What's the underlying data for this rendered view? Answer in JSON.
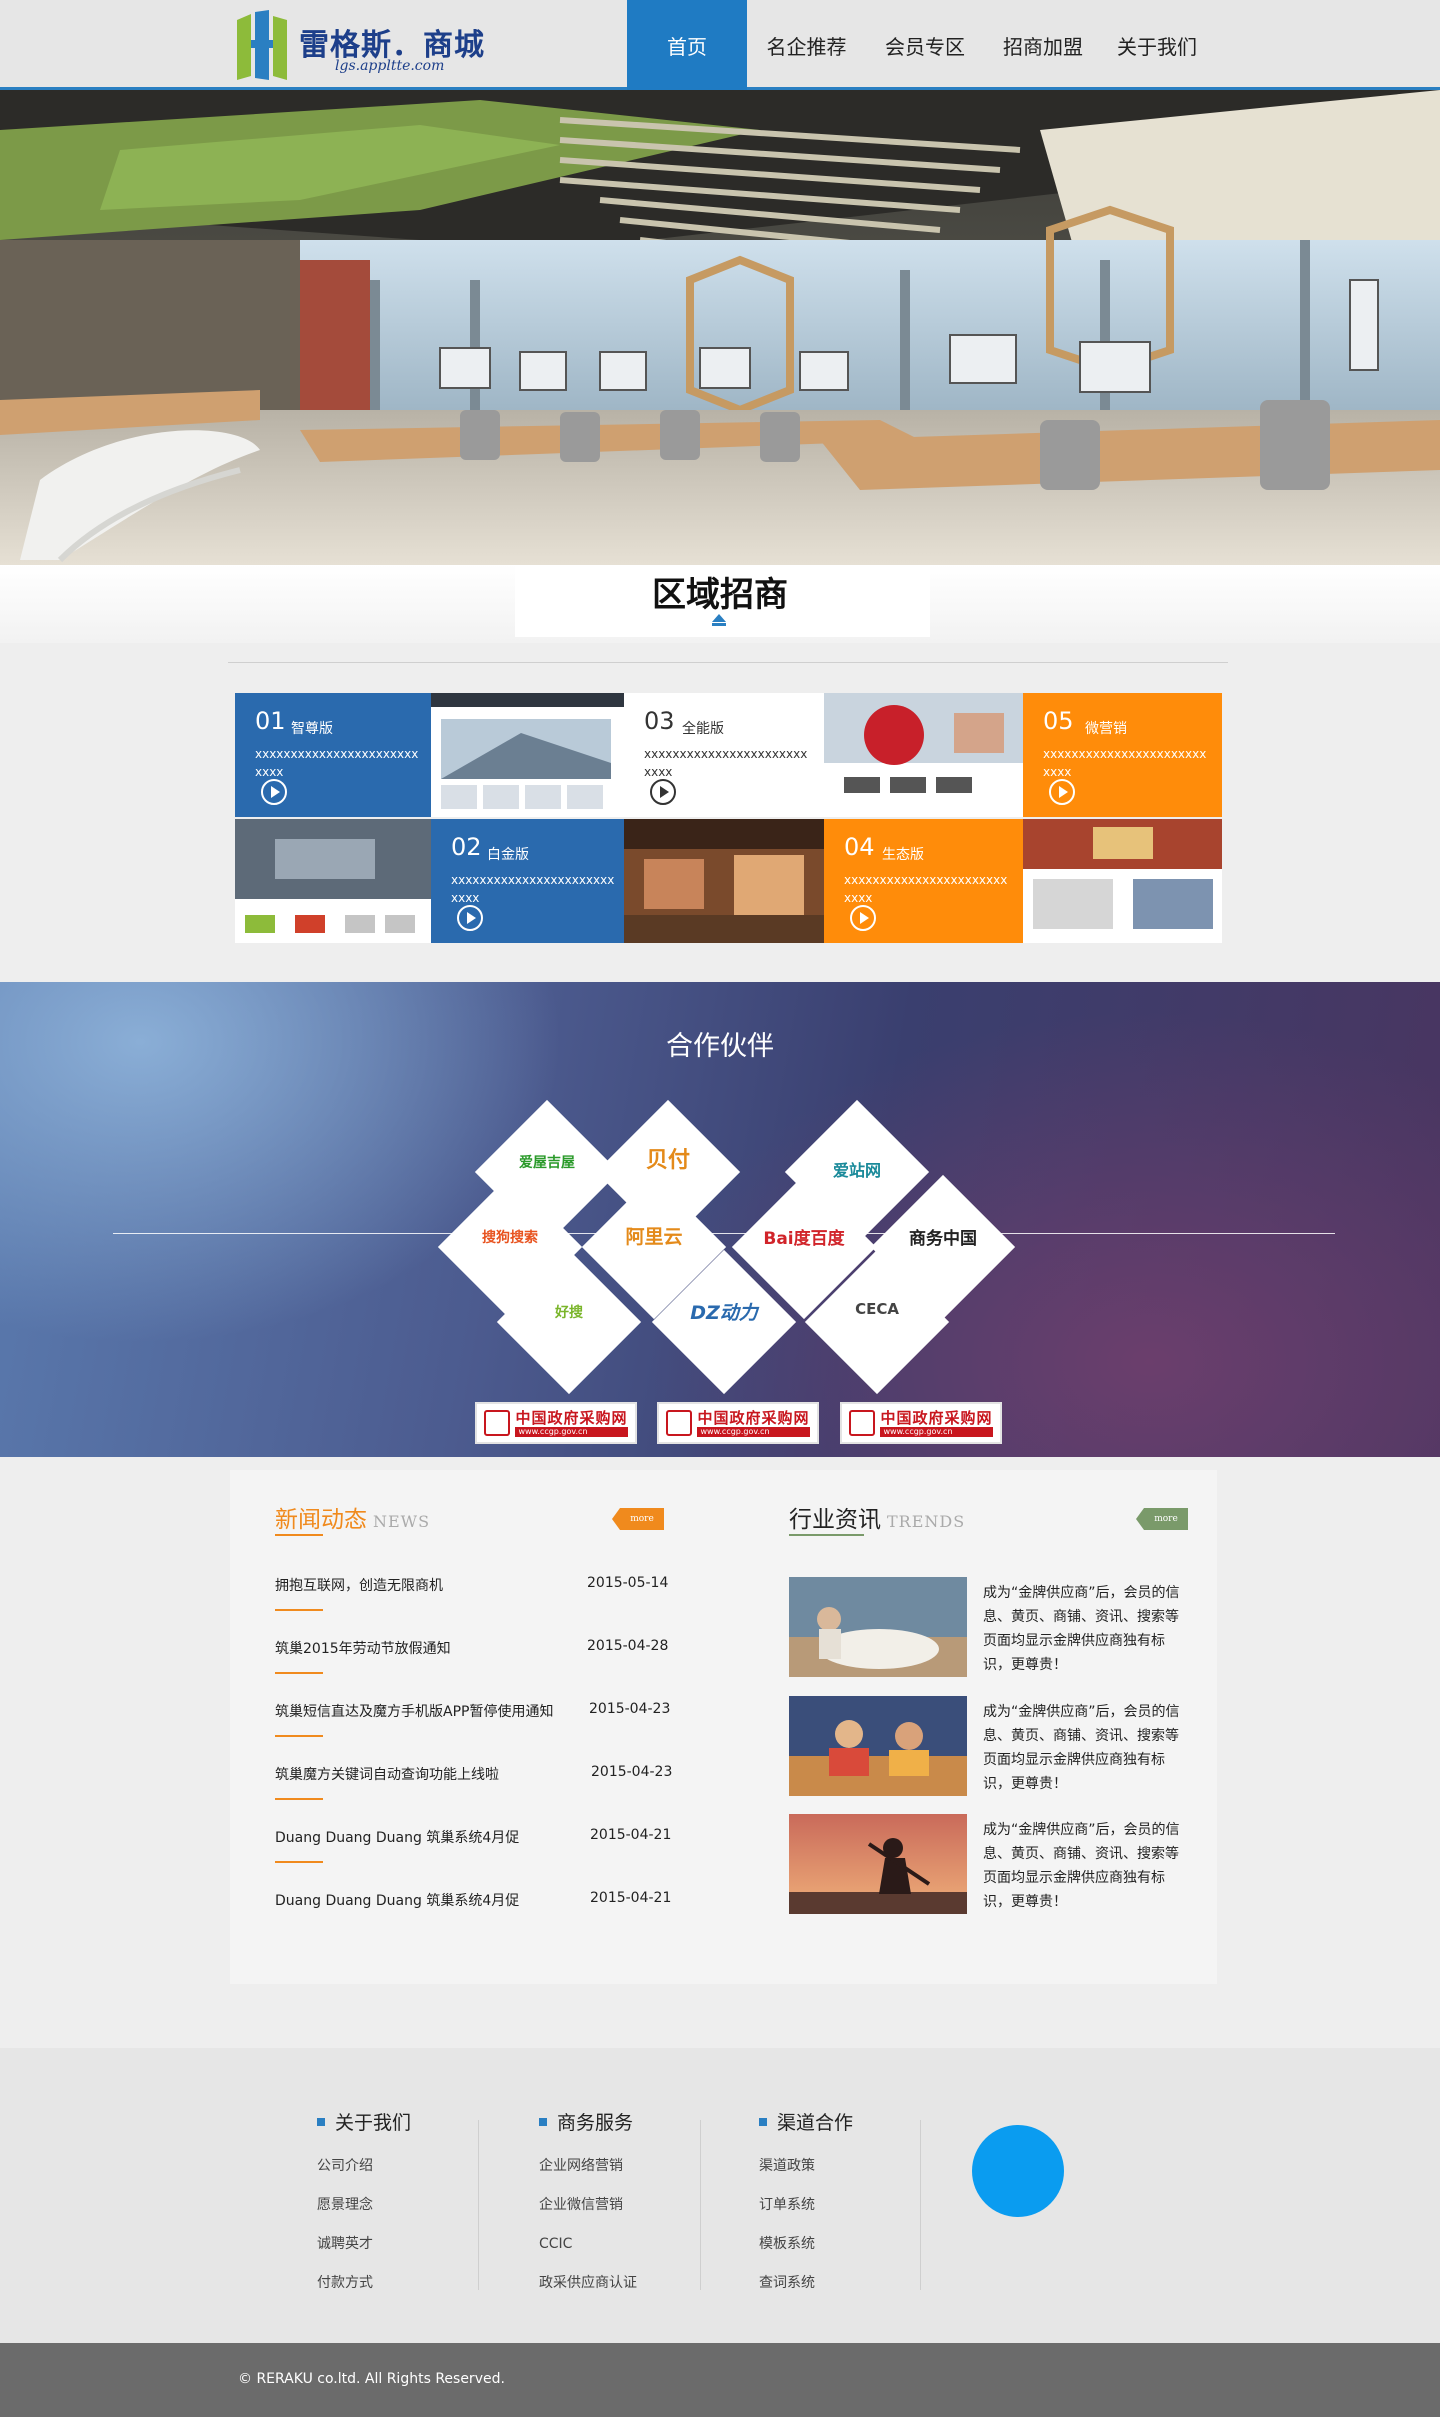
{
  "brand": {
    "name": "雷格斯．商城",
    "url": "lgs.appltte.com"
  },
  "nav": {
    "items": [
      "首页",
      "名企推荐",
      "会员专区",
      "招商加盟",
      "关于我们"
    ]
  },
  "region": {
    "title": "区域招商",
    "tiles": [
      {
        "num": "01",
        "edition": "智尊版",
        "desc": "xxxxxxxxxxxxxxxxxxxxxxxxxxx"
      },
      {
        "num": "02",
        "edition": "白金版",
        "desc": "xxxxxxxxxxxxxxxxxxxxxxxxxxx"
      },
      {
        "num": "03",
        "edition": "全能版",
        "desc": "xxxxxxxxxxxxxxxxxxxxxxxxxxx"
      },
      {
        "num": "04",
        "edition": "生态版",
        "desc": "xxxxxxxxxxxxxxxxxxxxxxxxxxx"
      },
      {
        "num": "05",
        "edition": "微营销",
        "desc": "xxxxxxxxxxxxxxxxxxxxxxxxxxx"
      }
    ]
  },
  "partners": {
    "title": "合作伙伴",
    "logos": [
      "爱屋吉屋",
      "贝付",
      "爱站网",
      "搜狗搜索",
      "阿里云",
      "Bai度百度",
      "商务中国",
      "好搜",
      "DZ动力",
      "CECA"
    ],
    "gov_label": "中国政府采购网",
    "gov_url": "www.ccgp.gov.cn"
  },
  "news": {
    "title": "新闻动态",
    "subtitle": "NEWS",
    "more": "more",
    "items": [
      {
        "title": "拥抱互联网，创造无限商机",
        "date": "2015-05-14"
      },
      {
        "title": "筑巢2015年劳动节放假通知",
        "date": "2015-04-28"
      },
      {
        "title": "筑巢短信直达及魔方手机版APP暂停使用通知",
        "date": "2015-04-23"
      },
      {
        "title": "筑巢魔方关键词自动查询功能上线啦",
        "date": "2015-04-23"
      },
      {
        "title": "Duang Duang Duang 筑巢系统4月促",
        "date": "2015-04-21"
      },
      {
        "title": "Duang Duang Duang 筑巢系统4月促",
        "date": "2015-04-21"
      }
    ]
  },
  "trends": {
    "title": "行业资讯",
    "subtitle": "TRENDS",
    "more": "more",
    "items": [
      {
        "text": "成为“金牌供应商”后，会员的信息、黄页、商铺、资讯、搜索等页面均显示金牌供应商独有标识，更尊贵！"
      },
      {
        "text": "成为“金牌供应商”后，会员的信息、黄页、商铺、资讯、搜索等页面均显示金牌供应商独有标识，更尊贵！"
      },
      {
        "text": "成为“金牌供应商”后，会员的信息、黄页、商铺、资讯、搜索等页面均显示金牌供应商独有标识，更尊贵！"
      }
    ]
  },
  "footer": {
    "columns": [
      {
        "heading": "关于我们",
        "links": [
          "公司介绍",
          "愿景理念",
          "诚聘英才",
          "付款方式"
        ]
      },
      {
        "heading": "商务服务",
        "links": [
          "企业网络营销",
          "企业微信营销",
          "CCIC",
          "政采供应商认证"
        ]
      },
      {
        "heading": "渠道合作",
        "links": [
          "渠道政策",
          "订单系统",
          "模板系统",
          "查词系统"
        ]
      }
    ],
    "copyright": "© RERAKU co.ltd. All Rights Reserved."
  },
  "colors": {
    "accent_blue": "#1f7bc3",
    "accent_orange": "#ff8c0a",
    "tile_blue": "#2a6aae",
    "news_orange": "#f08a1d",
    "trends_green": "#7a9a6a"
  }
}
